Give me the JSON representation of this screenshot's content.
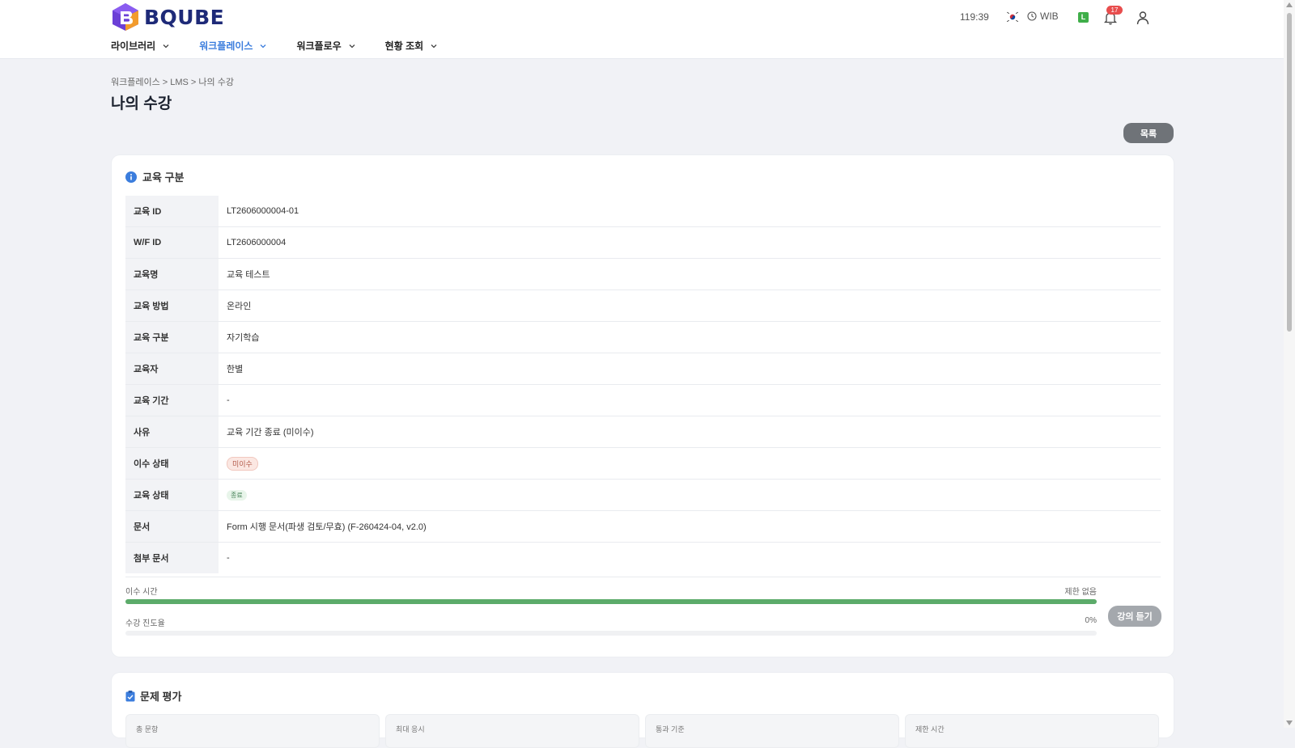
{
  "brand": {
    "name": "BQUBE"
  },
  "nav": {
    "items": [
      {
        "label": "라이브러리"
      },
      {
        "label": "워크플레이스",
        "active": true
      },
      {
        "label": "워크플로우"
      },
      {
        "label": "현황 조회"
      }
    ]
  },
  "topbar": {
    "session_timer": "119:39",
    "timezone": "WIB",
    "level_badge": "L",
    "notification_count": "17"
  },
  "breadcrumb": "워크플레이스 > LMS > 나의 수강",
  "page_title": "나의 수강",
  "list_button": "목록",
  "section1": {
    "title": "교육 구분",
    "rows": [
      {
        "label": "교육 ID",
        "value": "LT2606000004-01"
      },
      {
        "label": "W/F ID",
        "value": "LT2606000004"
      },
      {
        "label": "교육명",
        "value": "교육 테스트"
      },
      {
        "label": "교육 방법",
        "value": "온라인"
      },
      {
        "label": "교육 구분",
        "value": "자기학습"
      },
      {
        "label": "교육자",
        "value": "한별"
      },
      {
        "label": "교육 기간",
        "value": "-"
      },
      {
        "label": "사유",
        "value": "교육 기간 종료 (미이수)"
      },
      {
        "label": "이수 상태",
        "value": "미이수"
      },
      {
        "label": "교육 상태",
        "value": "종료"
      },
      {
        "label": "문서",
        "value": "Form 시행 문서(파생 검토/무효) (F-260424-04, v2.0)"
      },
      {
        "label": "첨부 문서",
        "value": "-"
      }
    ]
  },
  "progress": {
    "completion_time_label": "이수 시간",
    "completion_time_value": "제한 없음",
    "completion_time_fill": 1.0,
    "watch_progress_label": "수강 진도율",
    "watch_progress_value": "0%",
    "watch_progress_fill": 0.0,
    "lecture_button": "강의 듣기"
  },
  "section2": {
    "title": "문제 평가",
    "stats": [
      {
        "label": "총 문항"
      },
      {
        "label": "최대 응시"
      },
      {
        "label": "통과 기준"
      },
      {
        "label": "제한 시간"
      }
    ]
  },
  "colors": {
    "accent": "#3b7ddd",
    "progress_green": "#5cab6a",
    "badge_red": "#e84d4d",
    "brand_navy": "#1e2a78"
  }
}
